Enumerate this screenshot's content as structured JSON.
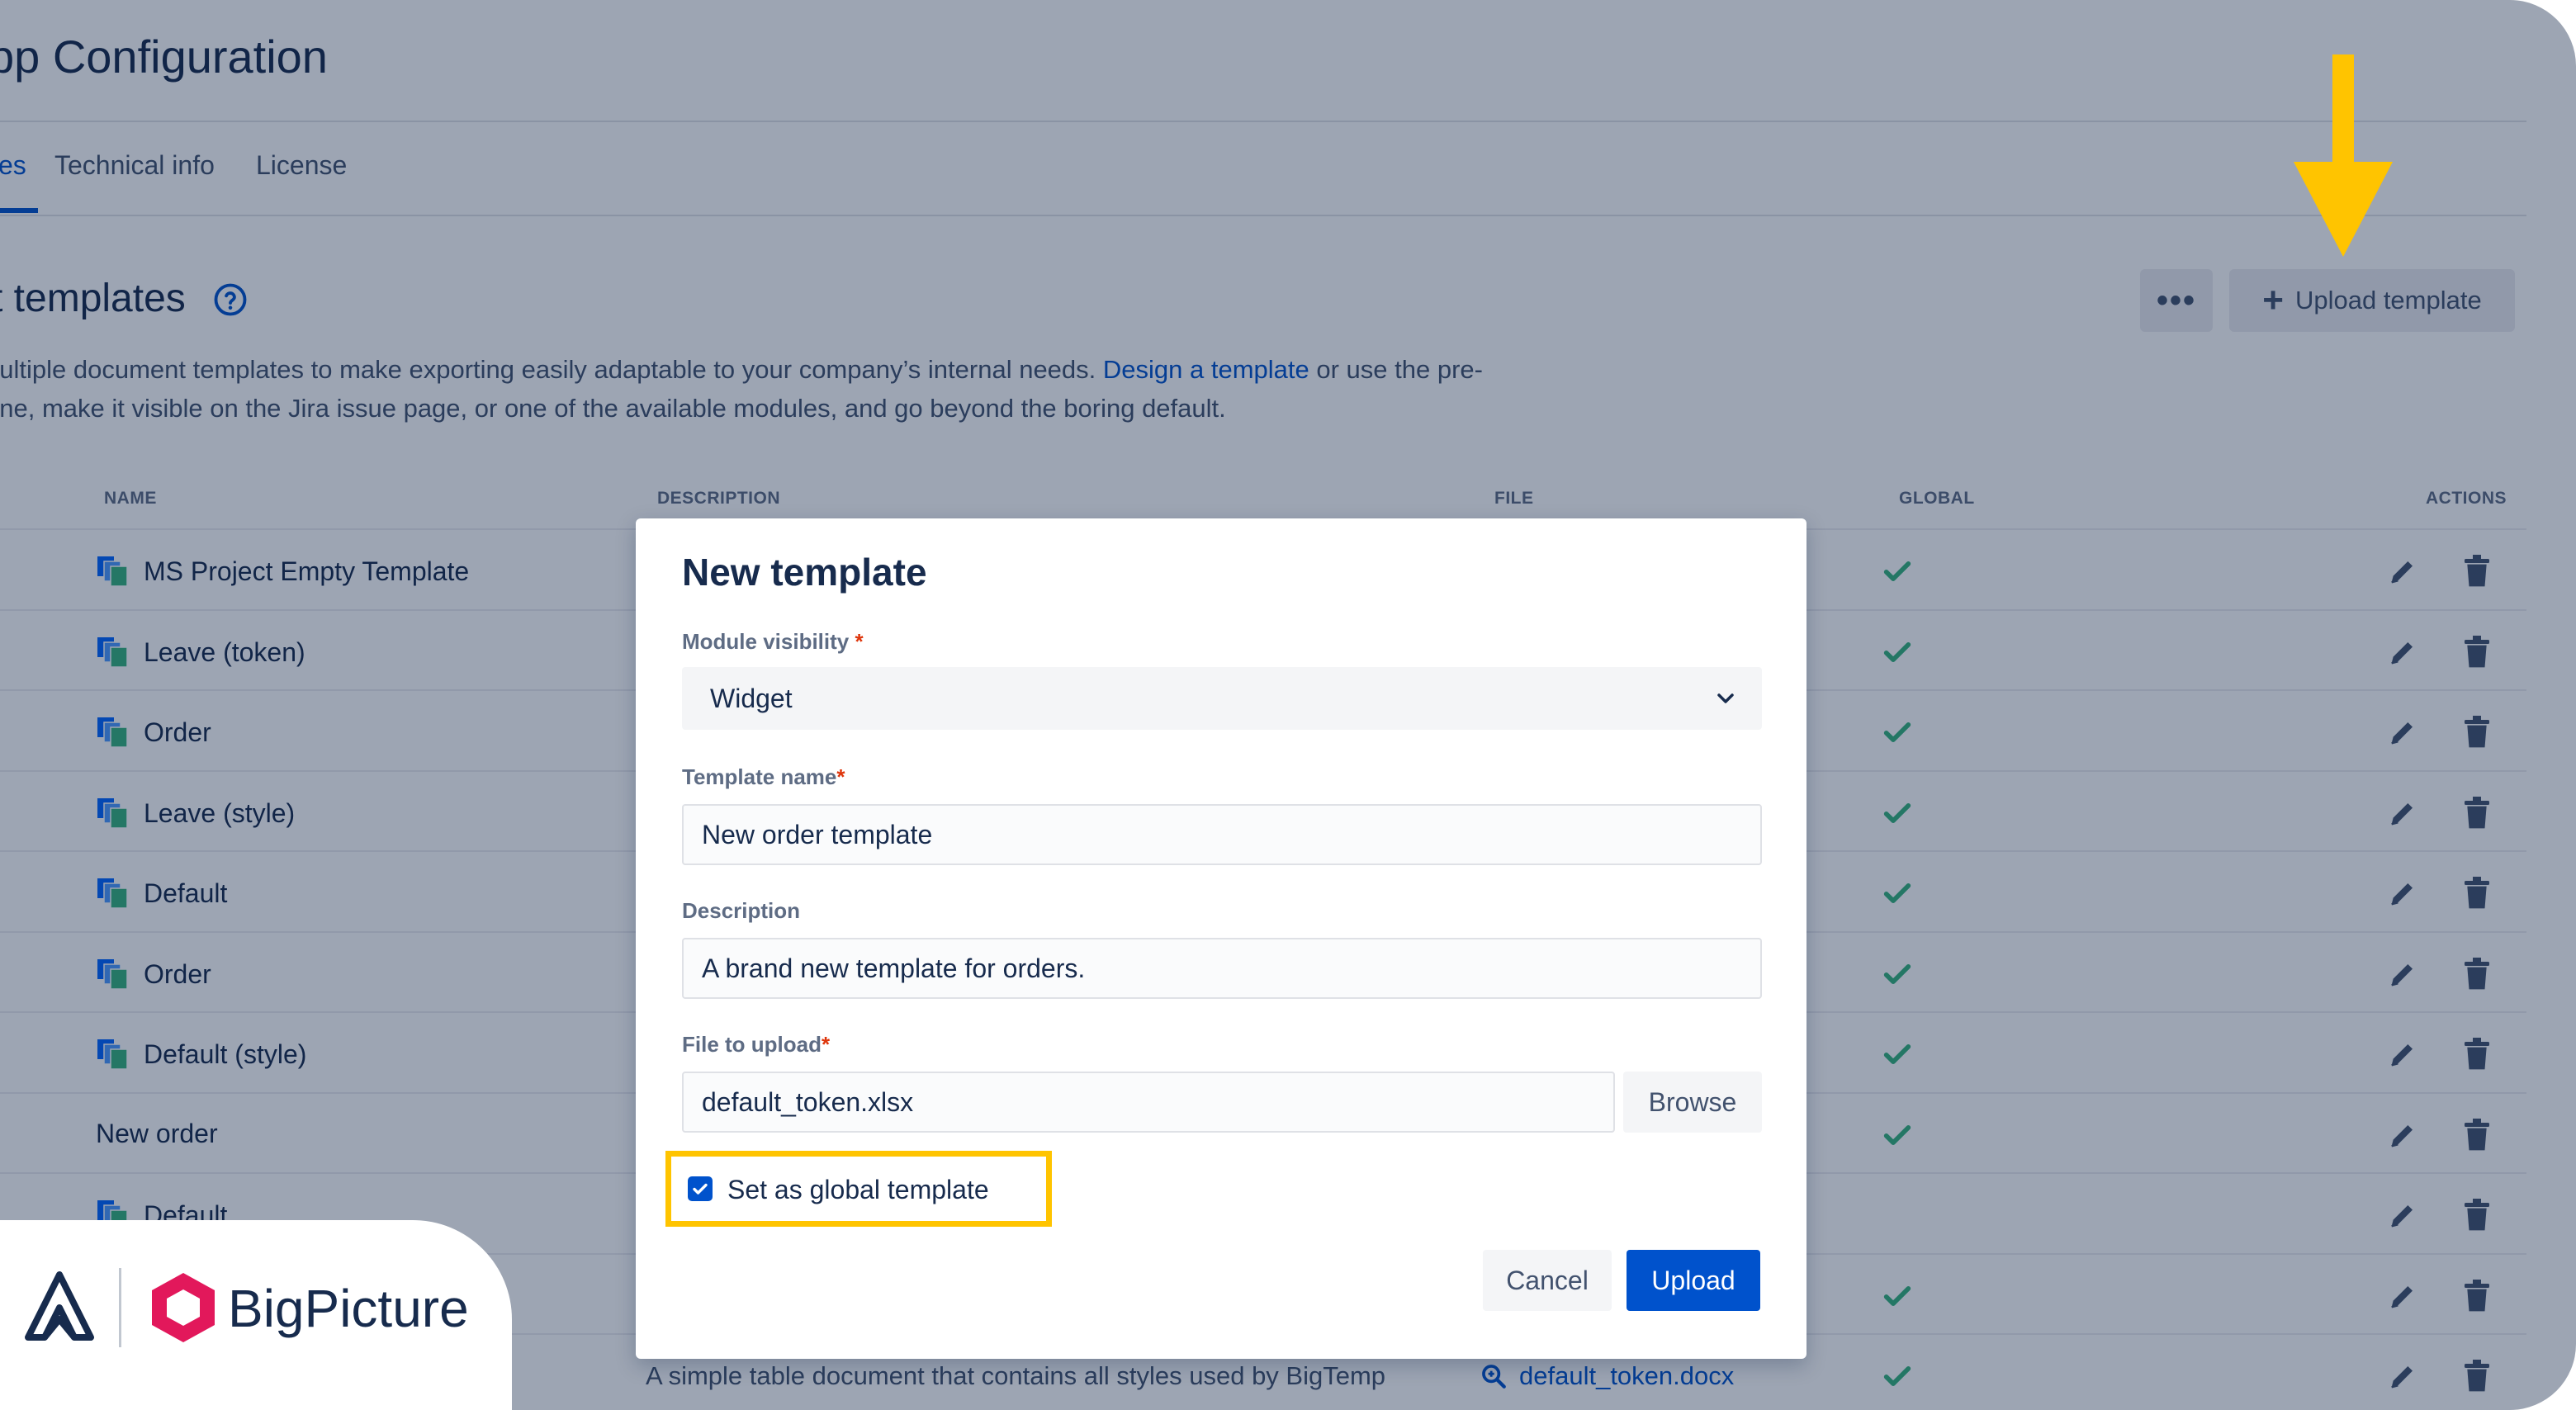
{
  "page": {
    "title": "pp Configuration",
    "tabs": [
      {
        "label": "es",
        "active": true
      },
      {
        "label": "Technical info",
        "active": false
      },
      {
        "label": "License",
        "active": false
      }
    ],
    "section_title": "t templates",
    "intro": {
      "line1_before": "nultiple document templates to make exporting easily adaptable to your company’s internal needs. ",
      "line1_link": "Design a template",
      "line1_after": " or use the pre-",
      "line2": "one, make it visible on the Jira issue page, or one of the available modules, and go beyond the boring default."
    },
    "toolbar": {
      "more_label": "•••",
      "upload_label": "Upload template"
    }
  },
  "table": {
    "headers": {
      "name": "NAME",
      "description": "DESCRIPTION",
      "file": "FILE",
      "global": "GLOBAL",
      "actions": "ACTIONS"
    },
    "rows": [
      {
        "name": "MS Project Empty Template",
        "has_icon": true,
        "global": true
      },
      {
        "name": "Leave (token)",
        "has_icon": true,
        "global": true
      },
      {
        "name": "Order",
        "has_icon": true,
        "global": true
      },
      {
        "name": "Leave (style)",
        "has_icon": true,
        "global": true
      },
      {
        "name": "Default",
        "has_icon": true,
        "global": true
      },
      {
        "name": "Order",
        "has_icon": true,
        "global": true
      },
      {
        "name": "Default (style)",
        "has_icon": true,
        "global": true
      },
      {
        "name": "New order",
        "has_icon": false,
        "global": true
      },
      {
        "name": "Default",
        "has_icon": true,
        "global": false
      },
      {
        "name": "",
        "has_icon": false,
        "global": true
      },
      {
        "name": "",
        "has_icon": false,
        "global": true,
        "description": "A simple table document that contains all styles used by BigTemp",
        "file": "default_token.docx"
      }
    ]
  },
  "modal": {
    "title": "New template",
    "module_visibility_label": "Module visibility",
    "module_visibility_value": "Widget",
    "template_name_label": "Template name",
    "template_name_value": "New order template",
    "description_label": "Description",
    "description_value": "A brand new template for orders.",
    "file_label": "File to upload",
    "file_value": "default_token.xlsx",
    "browse_label": "Browse",
    "global_checkbox_label": "Set as global template",
    "global_checked": true,
    "required_mark": "*",
    "cancel_label": "Cancel",
    "upload_label": "Upload"
  },
  "brand": {
    "name": "BigPicture"
  },
  "colors": {
    "highlight": "#ffc400",
    "primary": "#0052cc",
    "success": "#36b37e",
    "brand_pink": "#e2185b",
    "overlay": "rgba(9,30,66,0.4)"
  }
}
